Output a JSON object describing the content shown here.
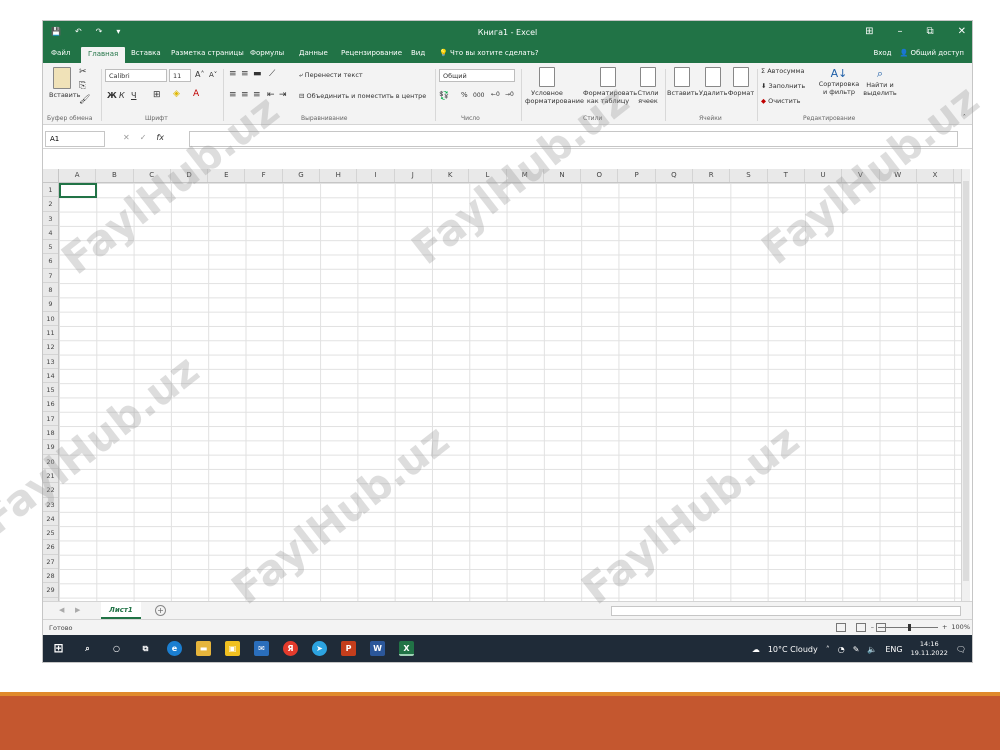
{
  "window": {
    "title": "Книга1 - Excel",
    "controls": [
      "⊞",
      "–",
      "⧉",
      "✕"
    ]
  },
  "tabs": {
    "items": [
      "Файл",
      "Главная",
      "Вставка",
      "Разметка страницы",
      "Формулы",
      "Данные",
      "Рецензирование",
      "Вид"
    ],
    "active": "Главная",
    "search_placeholder": "Что вы хотите сделать?",
    "signin": "Вход",
    "share": "Общий доступ"
  },
  "ribbon": {
    "paste_label": "Вставить",
    "font_name": "Calibri",
    "font_size": "11",
    "bold": "Ж",
    "italic": "К",
    "underline": "Ч",
    "wrap_text": "Перенести текст",
    "merge_center": "Объединить и поместить в центре",
    "number_format": "Общий",
    "percent": "%",
    "thousands": "000",
    "conditional_1": "Условное",
    "conditional_2": "форматирование",
    "format_table_1": "Форматировать",
    "format_table_2": "как таблицу",
    "cell_styles_1": "Стили",
    "cell_styles_2": "ячеек",
    "insert": "Вставить",
    "delete": "Удалить",
    "format": "Формат",
    "autosum": "Автосумма",
    "fill": "Заполнить",
    "clear": "Очистить",
    "sort_1": "Сортировка",
    "sort_2": "и фильтр",
    "find_1": "Найти и",
    "find_2": "выделить",
    "groups": {
      "clipboard": "Буфер обмена",
      "font": "Шрифт",
      "alignment": "Выравнивание",
      "number": "Число",
      "styles": "Стили",
      "cells": "Ячейки",
      "editing": "Редактирование"
    }
  },
  "formula_bar": {
    "name_box": "A1",
    "fx": "fx",
    "value": ""
  },
  "grid": {
    "columns": [
      "A",
      "B",
      "C",
      "D",
      "E",
      "F",
      "G",
      "H",
      "I",
      "J",
      "K",
      "L",
      "M",
      "N",
      "O",
      "P",
      "Q",
      "R",
      "S",
      "T",
      "U",
      "V",
      "W",
      "X"
    ],
    "rows": [
      "1",
      "2",
      "3",
      "4",
      "5",
      "6",
      "7",
      "8",
      "9",
      "10",
      "11",
      "12",
      "13",
      "14",
      "15",
      "16",
      "17",
      "18",
      "19",
      "20",
      "21",
      "22",
      "23",
      "24",
      "25",
      "26",
      "27",
      "28",
      "29",
      "30"
    ],
    "active_cell": "A1"
  },
  "sheets": {
    "tabs": [
      "Лист1"
    ],
    "add": "+"
  },
  "status": {
    "text": "Готово",
    "zoom": "100%"
  },
  "taskbar": {
    "weather": "10°C Cloudy",
    "lang": "ENG",
    "time": "14:16",
    "date": "19.11.2022"
  },
  "watermark": "FaylHub.uz",
  "colors": {
    "excel_green": "#217346",
    "taskbar": "#1f2b38",
    "band": "#c4572f",
    "band_stripe": "#e08a2c"
  }
}
